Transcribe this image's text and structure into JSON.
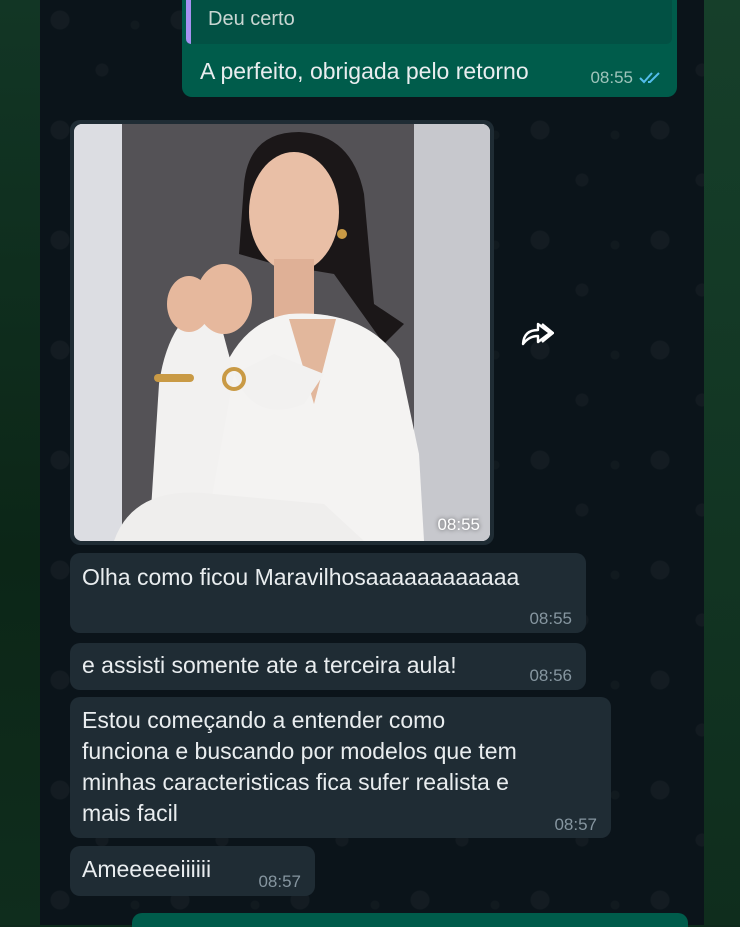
{
  "colors": {
    "chat_background": "#0b141a",
    "outgoing_bubble": "#005c4b",
    "incoming_bubble": "#1f2c34",
    "read_ticks": "#53bdeb",
    "quote_bar": "#a791f2"
  },
  "messages": [
    {
      "direction": "outgoing",
      "quoted_text": "Deu certo",
      "text": "A perfeito, obrigada pelo retorno",
      "time": "08:55",
      "status_icon": "double-check-read-icon"
    },
    {
      "direction": "incoming",
      "type": "image",
      "time": "08:55",
      "action_icon": "forward-icon"
    },
    {
      "direction": "incoming",
      "text": "Olha como ficou Maravilhosaaaaaaaaaaaa",
      "time": "08:55"
    },
    {
      "direction": "incoming",
      "text": "e assisti somente ate a terceira aula!",
      "time": "08:56"
    },
    {
      "direction": "incoming",
      "lines": [
        "Estou começando a entender como",
        "funciona e buscando por modelos que tem",
        "minhas caracteristicas fica sufer realista e",
        "mais facil"
      ],
      "time": "08:57"
    },
    {
      "direction": "incoming",
      "text": "Ameeeeeiiiiii",
      "time": "08:57"
    }
  ]
}
